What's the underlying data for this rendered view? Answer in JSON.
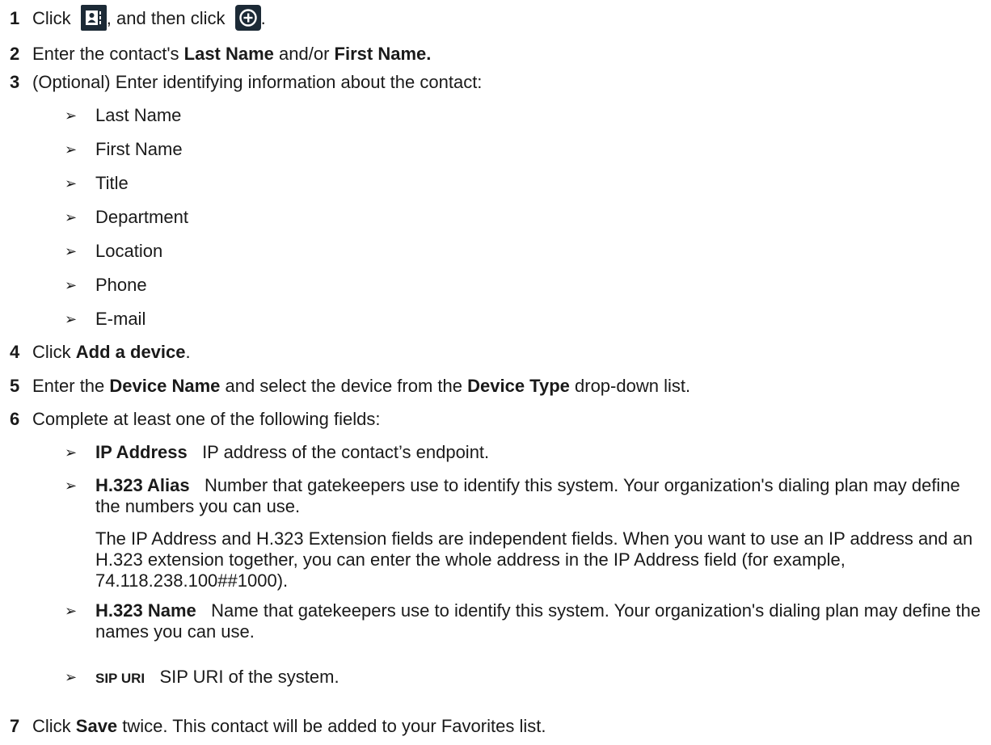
{
  "steps": [
    {
      "num": "1",
      "t1": "Click",
      "t2": ", and then click",
      "t3": "."
    },
    {
      "num": "2",
      "t1": "Enter the contact's ",
      "b1": "Last Name",
      "t2": " and/or ",
      "b2": "First Name."
    },
    {
      "num": "3",
      "t1": "(Optional) Enter identifying information about the contact:"
    },
    {
      "num": "4",
      "t1": "Click ",
      "b1": "Add a device",
      "t2": "."
    },
    {
      "num": "5",
      "t1": "Enter the ",
      "b1": "Device Name",
      "t2": " and select the device from the ",
      "b2": "Device Type",
      "t3": " drop-down list."
    },
    {
      "num": "6",
      "t1": "Complete at least one of the following fields:"
    },
    {
      "num": "7",
      "t1": "Click ",
      "b1": "Save",
      "t2": " twice. This contact will be added to your Favorites list."
    }
  ],
  "identifying_fields": [
    "Last Name",
    "First Name",
    "Title",
    "Department",
    "Location",
    "Phone",
    "E-mail"
  ],
  "device_fields": [
    {
      "label": "IP Address",
      "desc": "IP address of the contact’s endpoint."
    },
    {
      "label": "H.323 Alias",
      "desc": "Number that gatekeepers use to identify this system. Your organization's dialing plan may define the numbers you can use."
    },
    {
      "label": "H.323 Name",
      "desc": "Name that gatekeepers use to identify this system. Your organization's dialing plan may define the names you can use."
    },
    {
      "label": "SIP URI",
      "desc": "SIP URI of the system."
    }
  ],
  "note": "The IP Address and H.323 Extension fields are independent fields. When you want to use an IP address and an H.323 extension together, you can enter the whole address in the IP Address field (for example, 74.118.238.100##1000).",
  "bullet_glyph": "➢",
  "icons": {
    "first": "contacts-icon",
    "second": "add-circle-icon"
  }
}
